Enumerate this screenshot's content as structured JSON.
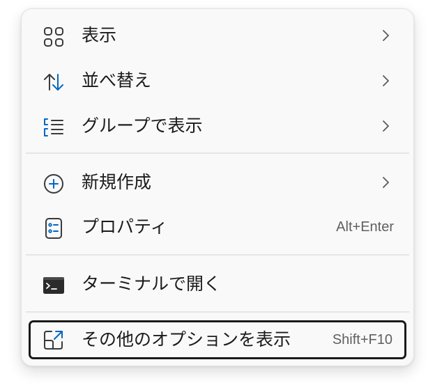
{
  "menu": {
    "items": [
      {
        "label": "表示",
        "icon": "grid-icon",
        "submenu": true
      },
      {
        "label": "並べ替え",
        "icon": "sort-icon",
        "submenu": true
      },
      {
        "label": "グループで表示",
        "icon": "group-list-icon",
        "submenu": true
      },
      {
        "label": "新規作成",
        "icon": "add-circle-icon",
        "submenu": true
      },
      {
        "label": "プロパティ",
        "icon": "properties-icon",
        "shortcut": "Alt+Enter"
      },
      {
        "label": "ターミナルで開く",
        "icon": "terminal-icon"
      },
      {
        "label": "その他のオプションを表示",
        "icon": "open-external-icon",
        "shortcut": "Shift+F10"
      }
    ]
  },
  "colors": {
    "accent": "#0067c0",
    "text": "#1b1b1b",
    "shortcut_text": "#5f5f5f",
    "menu_background": "#f9f9f9",
    "focus_border": "#1a1a1a"
  }
}
